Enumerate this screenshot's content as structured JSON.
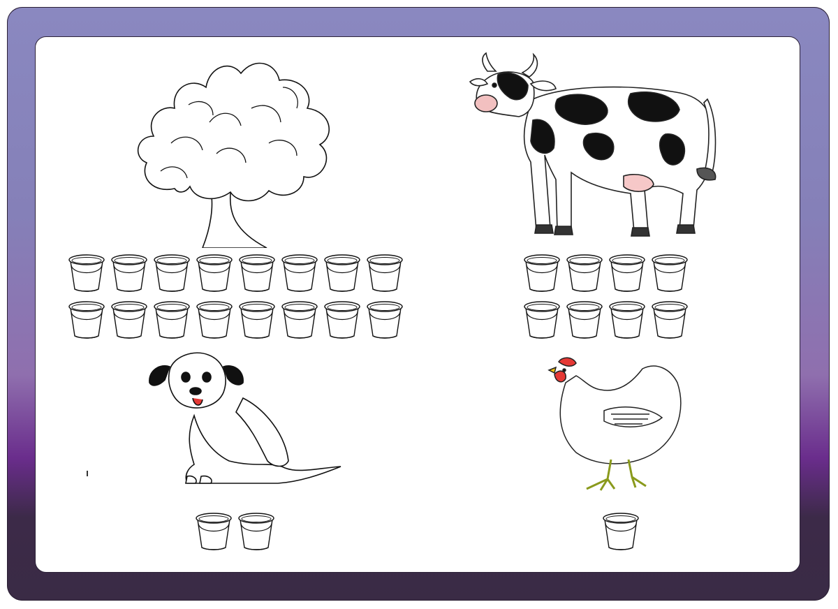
{
  "worksheet": {
    "frame_colors": {
      "top": "#8a88c0",
      "middle": "#8f6fae",
      "accent": "#6a2d8c",
      "bottom": "#3a2b45"
    },
    "items": [
      {
        "name": "tree",
        "icon": "tree-icon",
        "bucket_rows": [
          8,
          8
        ],
        "total_buckets": 16
      },
      {
        "name": "cow",
        "icon": "cow-icon",
        "bucket_rows": [
          4,
          4
        ],
        "total_buckets": 8
      },
      {
        "name": "dog",
        "icon": "dog-icon",
        "bucket_rows": [
          2
        ],
        "total_buckets": 2
      },
      {
        "name": "hen",
        "icon": "hen-icon",
        "bucket_rows": [
          1
        ],
        "total_buckets": 1
      }
    ]
  }
}
